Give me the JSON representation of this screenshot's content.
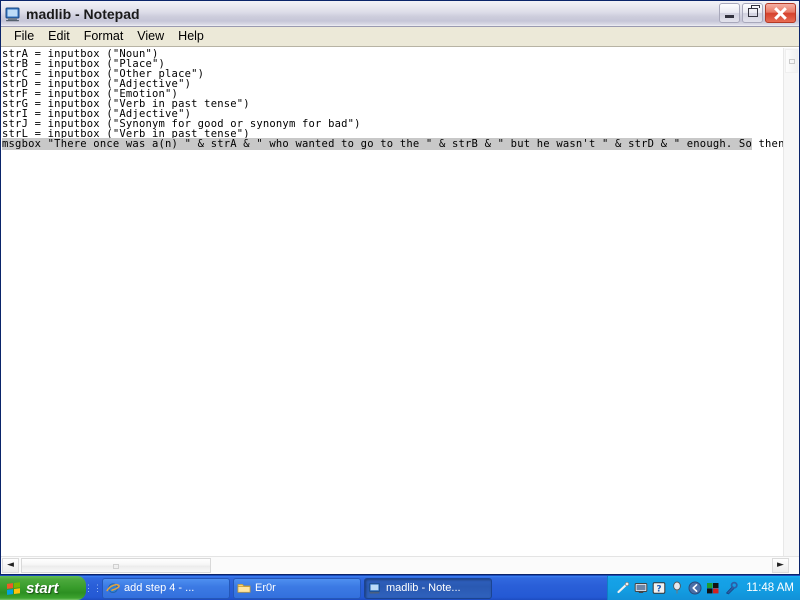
{
  "window": {
    "title": "madlib - Notepad",
    "icon": "notepad-icon",
    "buttons": {
      "minimize": "Minimize",
      "restore": "Restore",
      "close": "Close"
    }
  },
  "menu": {
    "items": [
      {
        "label": "File"
      },
      {
        "label": "Edit"
      },
      {
        "label": "Format"
      },
      {
        "label": "View"
      },
      {
        "label": "Help"
      }
    ]
  },
  "editor": {
    "lines": [
      {
        "text": "strA = inputbox (\"Noun\")",
        "selected": false
      },
      {
        "text": "strB = inputbox (\"Place\")",
        "selected": false
      },
      {
        "text": "strC = inputbox (\"Other place\")",
        "selected": false
      },
      {
        "text": "strD = inputbox (\"Adjective\")",
        "selected": false
      },
      {
        "text": "strF = inputbox (\"Emotion\")",
        "selected": false
      },
      {
        "text": "strG = inputbox (\"Verb in past tense\")",
        "selected": false
      },
      {
        "text": "strI = inputbox (\"Adjective\")",
        "selected": false
      },
      {
        "text": "strJ = inputbox (\"Synonym for good or synonym for bad\")",
        "selected": false
      },
      {
        "text": "strL = inputbox (\"Verb in past tense\")",
        "selected": false
      }
    ],
    "selected_line": {
      "selected_text": "msgbox \"There once was a(n) \" & strA & \" who wanted to go to the \" & strB & \" but he wasn't \" & strD & \" enough. So",
      "trailing_text": " then he w"
    },
    "scrollbars": {
      "h_left_arrow": "◄",
      "h_right_arrow": "►"
    }
  },
  "taskbar": {
    "start_label": "start",
    "start_icon": "windows-flag-icon",
    "buttons": [
      {
        "label": "add step 4 - ...",
        "icon": "internet-explorer-icon",
        "active": false
      },
      {
        "label": "Er0r",
        "icon": "folder-icon",
        "active": false
      },
      {
        "label": "madlib - Note...",
        "icon": "notepad-icon",
        "active": true
      }
    ],
    "tray": {
      "icons": [
        "pen-tablet-icon",
        "display-monitor-icon",
        "help-question-icon",
        "balloon-icon",
        "show-hidden-chevron-icon",
        "color-blocks-icon",
        "tool-wrench-icon"
      ],
      "clock": "11:48 AM"
    }
  },
  "colors": {
    "title_bar_start": "#f2f2f7",
    "title_bar_end": "#c6c6d8",
    "close_button": "#d5412c",
    "taskbar_blue": "#2a5fd8",
    "start_green": "#389c2b",
    "tray_blue": "#139fe4",
    "selection_gray": "#c8c8c8",
    "editor_background": "#ffffff",
    "menu_background": "#ece9d8"
  }
}
